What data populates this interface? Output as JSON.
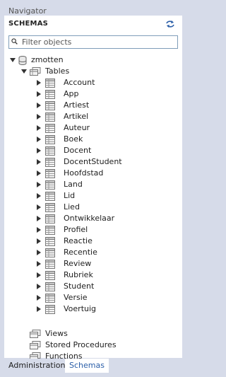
{
  "window": {
    "title": "Navigator"
  },
  "schemas": {
    "header": "SCHEMAS",
    "refresh_icon": "refresh-icon"
  },
  "filter": {
    "placeholder": "Filter objects",
    "value": ""
  },
  "tree": {
    "schema_name": "zmotten",
    "tables_label": "Tables",
    "tables": [
      "Account",
      "App",
      "Artiest",
      "Artikel",
      "Auteur",
      "Boek",
      "Docent",
      "DocentStudent",
      "Hoofdstad",
      "Land",
      "Lid",
      "Lied",
      "Ontwikkelaar",
      "Profiel",
      "Reactie",
      "Recentie",
      "Review",
      "Rubriek",
      "Student",
      "Versie",
      "Voertuig"
    ],
    "views_label": "Views",
    "procedures_label": "Stored Procedures",
    "functions_label": "Functions"
  },
  "tabs": [
    {
      "label": "Administration",
      "active": false
    },
    {
      "label": "Schemas",
      "active": true
    }
  ]
}
